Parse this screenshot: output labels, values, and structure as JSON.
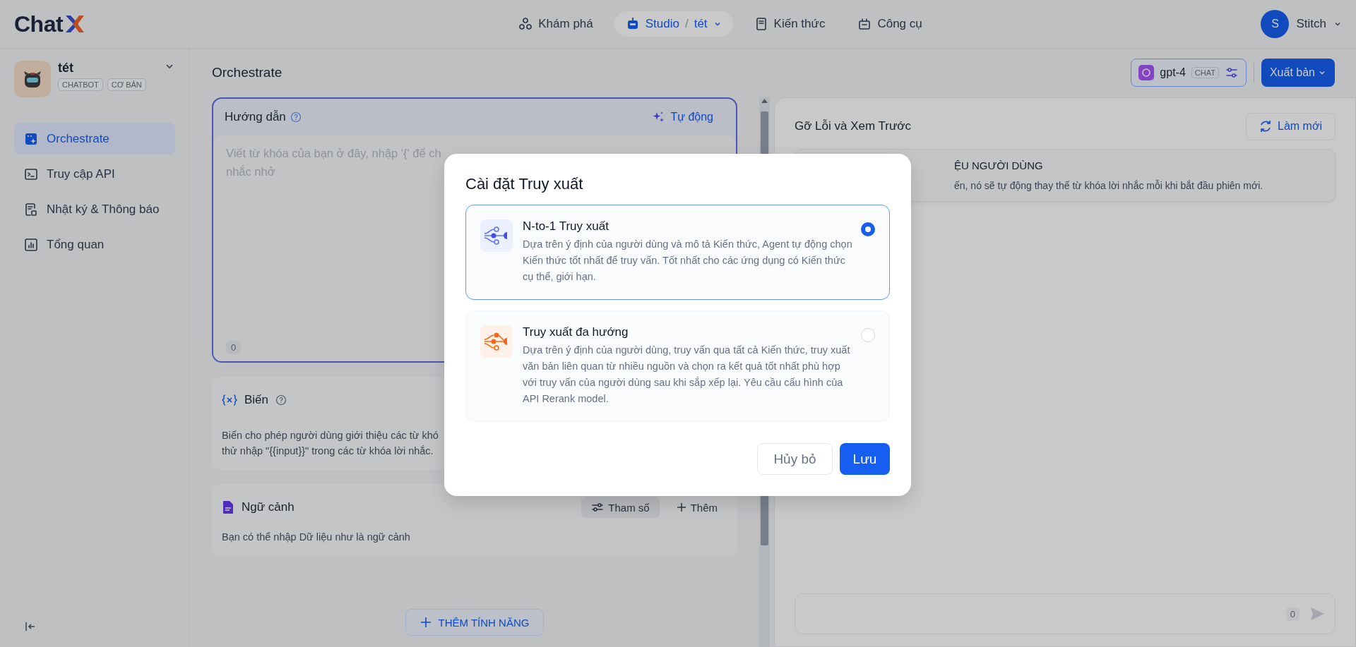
{
  "topbar": {
    "logo": "Chat",
    "nav": [
      {
        "label": "Khám phá",
        "kind": "explore",
        "selected": false
      },
      {
        "label": "Studio",
        "kind": "studio",
        "selected": true,
        "separator": "/",
        "app": "tét"
      },
      {
        "label": "Kiến thức",
        "kind": "knowledge",
        "selected": false
      },
      {
        "label": "Công cụ",
        "kind": "tools",
        "selected": false
      }
    ],
    "user": {
      "initial": "S",
      "name": "Stitch"
    }
  },
  "sidebar": {
    "app": {
      "name": "tét",
      "tags": [
        "CHATBOT",
        "CƠ BẢN"
      ]
    },
    "items": [
      {
        "label": "Orchestrate",
        "kind": "orchestrate",
        "selected": true
      },
      {
        "label": "Truy cập API",
        "kind": "api",
        "selected": false
      },
      {
        "label": "Nhật ký & Thông báo",
        "kind": "logs",
        "selected": false
      },
      {
        "label": "Tổng quan",
        "kind": "overview",
        "selected": false
      }
    ]
  },
  "main": {
    "title": "Orchestrate",
    "model": {
      "name": "gpt-4",
      "tag": "CHAT"
    },
    "publish": "Xuất bản",
    "instructions": {
      "title": "Hướng dẫn",
      "auto": "Tự động",
      "placeholder_lines": [
        "Viết từ khóa của bạn ở đây, nhập '{' để ch",
        "nhắc nhở"
      ],
      "count": "0"
    },
    "variables": {
      "title": "Biến",
      "description_lines": [
        "Biến cho phép người dùng giới thiệu các từ khó",
        "thử nhập \"{{input}}\" trong các từ khóa lời nhắc."
      ]
    },
    "context": {
      "title": "Ngữ cảnh",
      "params": "Tham số",
      "add": "Thêm",
      "description": "Bạn có thể nhập Dữ liệu như là ngữ cảnh"
    },
    "add_feature": "THÊM TÍNH NĂNG"
  },
  "preview": {
    "title": "Gỡ Lỗi và Xem Trước",
    "refresh": "Làm mới",
    "card": {
      "heading": "ỆU NGƯỜI DÙNG",
      "text": "ến, nó sẽ tự động thay thế từ khóa lời nhắc mỗi khi bắt đầu phiên mới."
    },
    "chat_count": "0"
  },
  "modal": {
    "title": "Cài đặt Truy xuất",
    "options": [
      {
        "kind": "single",
        "title": "N-to-1 Truy xuất",
        "description": "Dựa trên ý định của người dùng và mô tả Kiến thức, Agent tự động chọn Kiến thức tốt nhất để truy vấn. Tốt nhất cho các ứng dụng có Kiến thức cụ thể, giới hạn.",
        "selected": true
      },
      {
        "kind": "multi",
        "title": "Truy xuất đa hướng",
        "description": "Dựa trên ý định của người dùng, truy vấn qua tất cả Kiến thức, truy xuất văn bản liên quan từ nhiều nguồn và chọn ra kết quả tốt nhất phù hợp với truy vấn của người dùng sau khi sắp xếp lại. Yêu cầu cấu hình của API Rerank model.",
        "selected": false
      }
    ],
    "cancel": "Hủy bỏ",
    "save": "Lưu"
  }
}
